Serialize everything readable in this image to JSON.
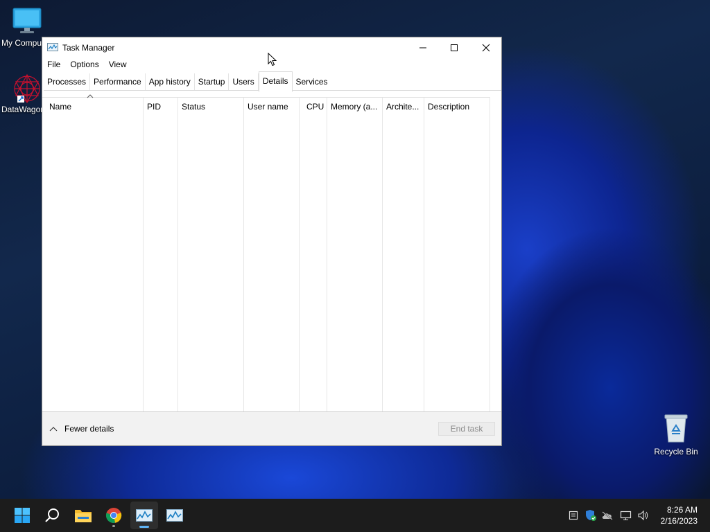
{
  "desktop": {
    "icons": [
      {
        "label": "My Compu"
      },
      {
        "label": "DataWagon"
      },
      {
        "label": "Recycle Bin"
      }
    ]
  },
  "window": {
    "title": "Task Manager",
    "menu": [
      "File",
      "Options",
      "View"
    ],
    "tabs": [
      "Processes",
      "Performance",
      "App history",
      "Startup",
      "Users",
      "Details",
      "Services"
    ],
    "active_tab": "Details",
    "columns": [
      "Name",
      "PID",
      "Status",
      "User name",
      "CPU",
      "Memory (a...",
      "Archite...",
      "Description"
    ],
    "footer": {
      "fewer_details": "Fewer details",
      "end_task": "End task"
    }
  },
  "taskbar": {
    "time": "8:26 AM",
    "date": "2/16/2023"
  },
  "colors": {
    "accent": "#0078d4",
    "taskbar": "#1c1c1c",
    "indicator": "#5fb2f2"
  }
}
